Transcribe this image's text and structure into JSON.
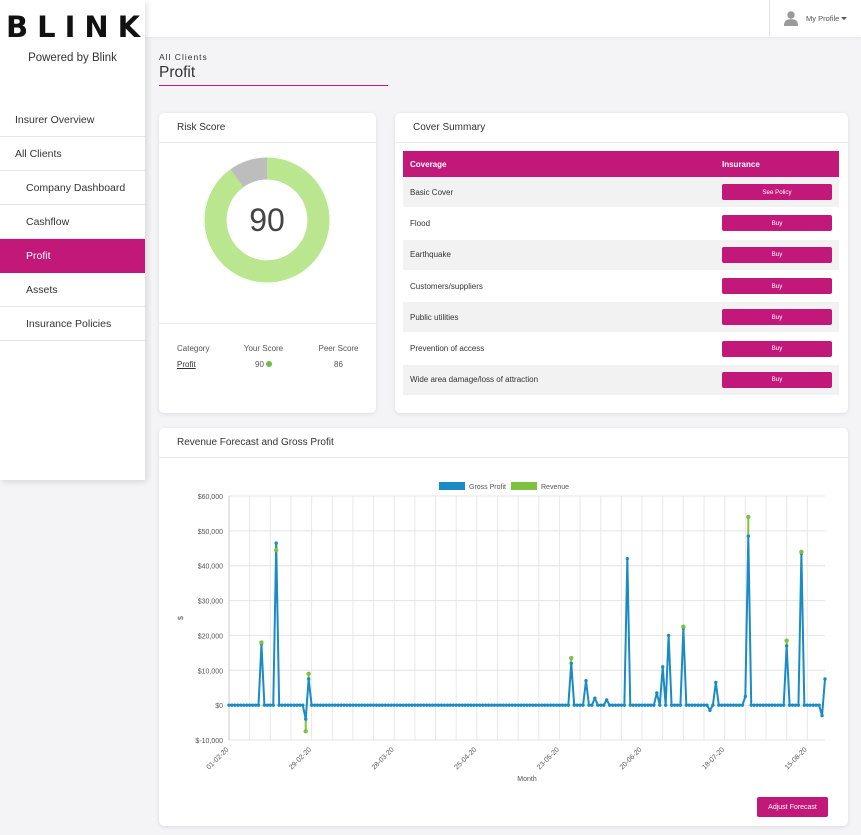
{
  "brand": {
    "logo_text": "BLINK",
    "tagline": "Powered by Blink",
    "accent_color": "#c2187a"
  },
  "sidebar": {
    "items": [
      {
        "label": "Insurer Overview",
        "level": 0,
        "active": false
      },
      {
        "label": "All Clients",
        "level": 0,
        "active": false
      },
      {
        "label": "Company Dashboard",
        "level": 1,
        "active": false
      },
      {
        "label": "Cashflow",
        "level": 1,
        "active": false
      },
      {
        "label": "Profit",
        "level": 1,
        "active": true
      },
      {
        "label": "Assets",
        "level": 1,
        "active": false
      },
      {
        "label": "Insurance Policies",
        "level": 1,
        "active": false
      }
    ]
  },
  "topbar": {
    "profile_label": "My Profile",
    "profile_icon": "user-icon"
  },
  "header": {
    "breadcrumb": "All Clients",
    "title": "Profit"
  },
  "risk_score": {
    "title": "Risk Score",
    "score": "90",
    "score_fraction": 0.9,
    "ring_color": "#b9e68e",
    "remainder_color": "#bdbdbd",
    "columns": [
      "Category",
      "Your Score",
      "Peer Score"
    ],
    "row": {
      "category": "Profit",
      "your_score": "90",
      "peer_score": "86"
    }
  },
  "cover_summary": {
    "title": "Cover Summary",
    "columns": [
      "Coverage",
      "Insurance"
    ],
    "rows": [
      {
        "coverage": "Basic Cover",
        "action": "See Policy"
      },
      {
        "coverage": "Flood",
        "action": "Buy"
      },
      {
        "coverage": "Earthquake",
        "action": "Buy"
      },
      {
        "coverage": "Customers/suppliers",
        "action": "Buy"
      },
      {
        "coverage": "Public utilities",
        "action": "Buy"
      },
      {
        "coverage": "Prevention of access",
        "action": "Buy"
      },
      {
        "coverage": "Wide area damage/loss of attraction",
        "action": "Buy"
      }
    ]
  },
  "revenue_card": {
    "title": "Revenue Forecast and Gross Profit",
    "adjust_label": "Adjust Forecast"
  },
  "chart_data": {
    "type": "line",
    "title": "",
    "xlabel": "Month",
    "ylabel": "$",
    "ylim": [
      -10000,
      60000
    ],
    "yticks": [
      -10000,
      0,
      10000,
      20000,
      30000,
      40000,
      50000,
      60000
    ],
    "ytick_labels": [
      "$-10,000",
      "$0",
      "$10,000",
      "$20,000",
      "$30,000",
      "$40,000",
      "$50,000",
      "$60,000"
    ],
    "x_start": "2020-02-01",
    "x_end": "2020-08-21",
    "xtick_labels": [
      "01-02-20",
      "29-02-20",
      "28-03-20",
      "25-04-20",
      "23-05-20",
      "20-06-20",
      "18-07-20",
      "15-08-20"
    ],
    "grid": true,
    "legend": "top",
    "series": [
      {
        "name": "Gross Profit",
        "color": "#1a8bc4",
        "points": [
          [
            "2020-02-11",
            0
          ],
          [
            "2020-02-12",
            17500
          ],
          [
            "2020-02-13",
            0
          ],
          [
            "2020-02-16",
            0
          ],
          [
            "2020-02-17",
            46500
          ],
          [
            "2020-02-18",
            0
          ],
          [
            "2020-02-26",
            0
          ],
          [
            "2020-02-27",
            -4000
          ],
          [
            "2020-02-28",
            7500
          ],
          [
            "2020-05-26",
            0
          ],
          [
            "2020-05-27",
            12000
          ],
          [
            "2020-05-28",
            0
          ],
          [
            "2020-05-31",
            0
          ],
          [
            "2020-06-01",
            7000
          ],
          [
            "2020-06-02",
            0
          ],
          [
            "2020-06-03",
            0
          ],
          [
            "2020-06-04",
            2000
          ],
          [
            "2020-06-05",
            0
          ],
          [
            "2020-06-07",
            0
          ],
          [
            "2020-06-08",
            1500
          ],
          [
            "2020-06-09",
            0
          ],
          [
            "2020-06-14",
            0
          ],
          [
            "2020-06-15",
            42000
          ],
          [
            "2020-06-16",
            0
          ],
          [
            "2020-06-24",
            0
          ],
          [
            "2020-06-25",
            3500
          ],
          [
            "2020-06-26",
            0
          ],
          [
            "2020-06-27",
            11000
          ],
          [
            "2020-06-28",
            0
          ],
          [
            "2020-06-29",
            20000
          ],
          [
            "2020-06-30",
            0
          ],
          [
            "2020-07-03",
            0
          ],
          [
            "2020-07-04",
            22000
          ],
          [
            "2020-07-05",
            0
          ],
          [
            "2020-07-12",
            0
          ],
          [
            "2020-07-13",
            -1500
          ],
          [
            "2020-07-14",
            0
          ],
          [
            "2020-07-15",
            6500
          ],
          [
            "2020-07-16",
            0
          ],
          [
            "2020-07-24",
            0
          ],
          [
            "2020-07-25",
            2500
          ],
          [
            "2020-07-26",
            48500
          ],
          [
            "2020-07-27",
            0
          ],
          [
            "2020-08-07",
            0
          ],
          [
            "2020-08-08",
            17000
          ],
          [
            "2020-08-09",
            0
          ],
          [
            "2020-08-12",
            0
          ],
          [
            "2020-08-13",
            43500
          ],
          [
            "2020-08-14",
            0
          ],
          [
            "2020-08-19",
            0
          ],
          [
            "2020-08-20",
            -3000
          ],
          [
            "2020-08-21",
            7500
          ]
        ]
      },
      {
        "name": "Revenue",
        "color": "#7ec242",
        "points": [
          [
            "2020-02-12",
            18000
          ],
          [
            "2020-02-17",
            44500
          ],
          [
            "2020-02-27",
            -7500
          ],
          [
            "2020-02-28",
            9000
          ],
          [
            "2020-05-27",
            13500
          ],
          [
            "2020-07-04",
            22500
          ],
          [
            "2020-07-26",
            54000
          ],
          [
            "2020-08-08",
            18500
          ],
          [
            "2020-08-13",
            44000
          ]
        ]
      }
    ]
  }
}
